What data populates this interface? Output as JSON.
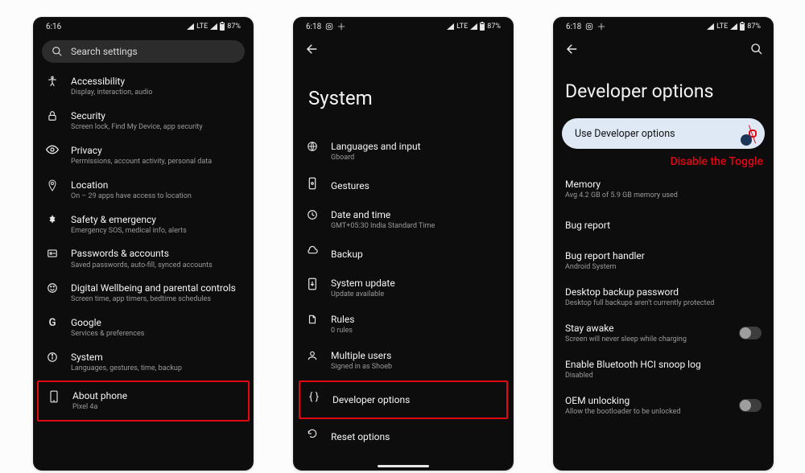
{
  "colors": {
    "highlight": "#e30613"
  },
  "phone1": {
    "status": {
      "time": "6:16",
      "net": "LTE",
      "battery": "87%"
    },
    "search_placeholder": "Search settings",
    "items": [
      {
        "icon": "accessibility-icon",
        "title": "Accessibility",
        "sub": "Display, interaction, audio"
      },
      {
        "icon": "lock-icon",
        "title": "Security",
        "sub": "Screen lock, Find My Device, app security"
      },
      {
        "icon": "eye-icon",
        "title": "Privacy",
        "sub": "Permissions, account activity, personal data"
      },
      {
        "icon": "location-icon",
        "title": "Location",
        "sub": "On – 29 apps have access to location"
      },
      {
        "icon": "medical-icon",
        "title": "Safety & emergency",
        "sub": "Emergency SOS, medical info, alerts"
      },
      {
        "icon": "passwords-icon",
        "title": "Passwords & accounts",
        "sub": "Saved passwords, auto-fill, synced accounts"
      },
      {
        "icon": "wellbeing-icon",
        "title": "Digital Wellbeing and parental controls",
        "sub": "Screen time, app timers, bedtime schedules"
      },
      {
        "icon": "google-icon",
        "title": "Google",
        "sub": "Services & preferences"
      },
      {
        "icon": "info-icon",
        "title": "System",
        "sub": "Languages, gestures, time, backup"
      },
      {
        "icon": "phone-icon",
        "title": "About phone",
        "sub": "Pixel 4a",
        "highlight": true
      }
    ]
  },
  "phone2": {
    "status": {
      "time": "6:18",
      "net": "LTE",
      "battery": "87%"
    },
    "title": "System",
    "items": [
      {
        "icon": "globe-icon",
        "title": "Languages and input",
        "sub": "Gboard"
      },
      {
        "icon": "gestures-icon",
        "title": "Gestures",
        "sub": ""
      },
      {
        "icon": "clock-icon",
        "title": "Date and time",
        "sub": "GMT+05:30 India Standard Time"
      },
      {
        "icon": "cloud-icon",
        "title": "Backup",
        "sub": ""
      },
      {
        "icon": "system-update-icon",
        "title": "System update",
        "sub": "Update available"
      },
      {
        "icon": "rules-icon",
        "title": "Rules",
        "sub": "0 rules"
      },
      {
        "icon": "users-icon",
        "title": "Multiple users",
        "sub": "Signed in as Shoeb"
      },
      {
        "icon": "braces-icon",
        "title": "Developer options",
        "sub": "",
        "highlight": true
      },
      {
        "icon": "reset-icon",
        "title": "Reset options",
        "sub": ""
      }
    ]
  },
  "phone3": {
    "status": {
      "time": "6:18",
      "net": "LTE",
      "battery": "87%"
    },
    "title": "Developer options",
    "toggle": {
      "label": "Use Developer options",
      "on": true
    },
    "annotation": "Disable the Toggle",
    "items": [
      {
        "title": "Memory",
        "sub": "Avg 4.2 GB of 5.9 GB memory used"
      },
      {
        "title": "Bug report",
        "sub": ""
      },
      {
        "title": "Bug report handler",
        "sub": "Android System"
      },
      {
        "title": "Desktop backup password",
        "sub": "Desktop full backups aren't currently protected"
      },
      {
        "title": "Stay awake",
        "sub": "Screen will never sleep while charging",
        "switch": "off"
      },
      {
        "title": "Enable Bluetooth HCI snoop log",
        "sub": "Disabled"
      },
      {
        "title": "OEM unlocking",
        "sub": "Allow the bootloader to be unlocked",
        "switch": "off"
      }
    ]
  }
}
